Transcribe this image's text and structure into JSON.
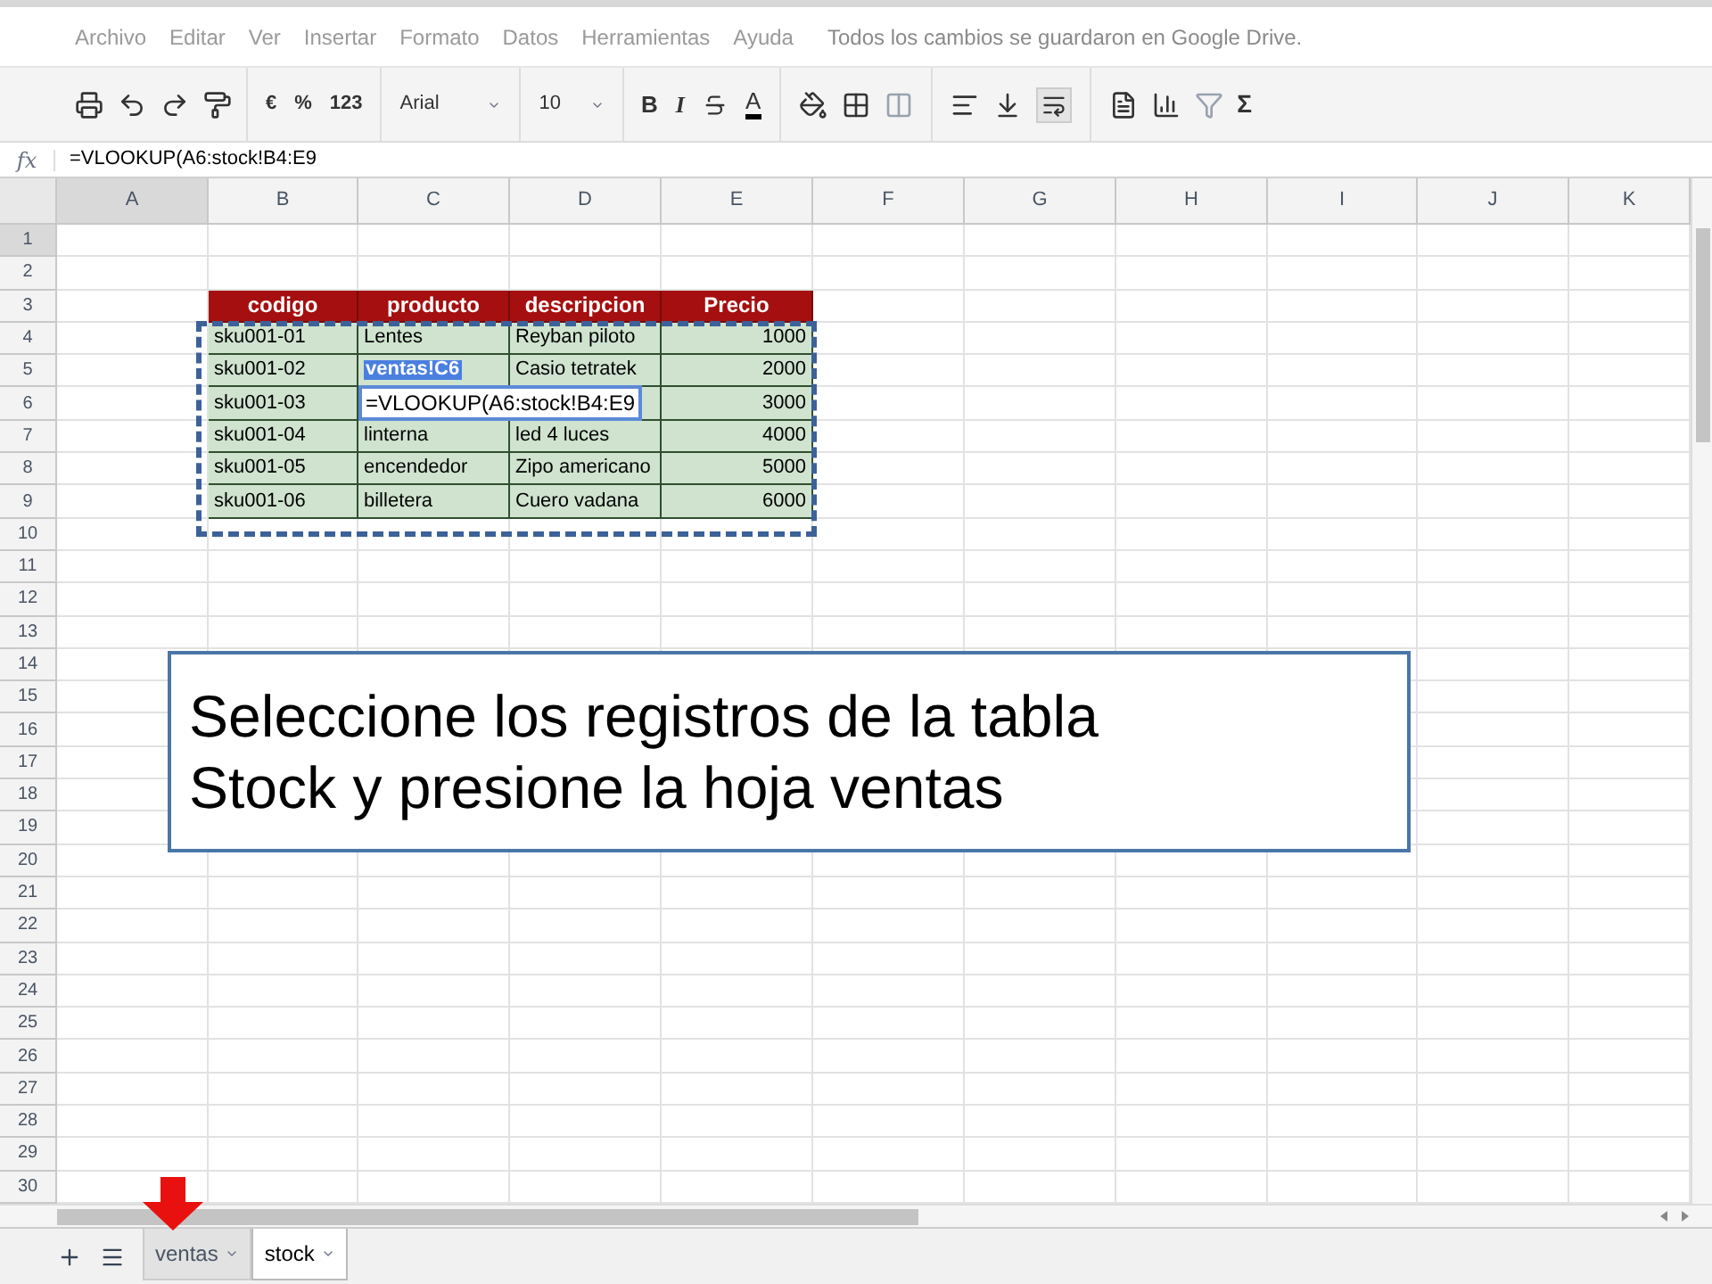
{
  "menu": {
    "items": [
      "Archivo",
      "Editar",
      "Ver",
      "Insertar",
      "Formato",
      "Datos",
      "Herramientas",
      "Ayuda"
    ],
    "save_status": "Todos los cambios se guardaron en Google Drive."
  },
  "toolbar": {
    "currency": "€",
    "percent": "%",
    "number_format": "123",
    "font": "Arial",
    "font_size": "10",
    "bold": "B",
    "italic": "I",
    "text_color": "A",
    "functions": "Σ"
  },
  "formula_bar": {
    "label": "fx",
    "value": "=VLOOKUP(A6:stock!B4:E9"
  },
  "grid": {
    "columns": [
      "A",
      "B",
      "C",
      "D",
      "E",
      "F",
      "G",
      "H",
      "I",
      "J",
      "K"
    ],
    "row_numbers": [
      "1",
      "2",
      "3",
      "4",
      "5",
      "6",
      "7",
      "8",
      "9",
      "10",
      "11",
      "12",
      "13",
      "14",
      "15",
      "16",
      "17",
      "18",
      "19",
      "20",
      "21",
      "22",
      "23",
      "24",
      "25",
      "26",
      "27",
      "28",
      "29",
      "30"
    ],
    "table": {
      "header": [
        "codigo",
        "producto",
        "descripcion",
        "Precio"
      ],
      "rows": [
        [
          {
            "kind": "text",
            "text": "sku001-01"
          },
          {
            "kind": "text",
            "text": "Lentes"
          },
          {
            "kind": "text",
            "text": "Reyban piloto"
          },
          {
            "kind": "number",
            "text": "1000"
          }
        ],
        [
          {
            "kind": "text",
            "text": "sku001-02"
          },
          {
            "kind": "reference",
            "text": "ventas!C6"
          },
          {
            "kind": "text",
            "text": "Casio tetratek"
          },
          {
            "kind": "number",
            "text": "2000"
          }
        ],
        [
          {
            "kind": "text",
            "text": "sku001-03"
          },
          {
            "kind": "editor",
            "text": "=VLOOKUP(A6:stock!B4:E9"
          },
          {
            "kind": "covered"
          },
          {
            "kind": "number",
            "text": "3000"
          }
        ],
        [
          {
            "kind": "text",
            "text": "sku001-04"
          },
          {
            "kind": "text",
            "text": "linterna"
          },
          {
            "kind": "text",
            "text": "led 4 luces"
          },
          {
            "kind": "number",
            "text": "4000"
          }
        ],
        [
          {
            "kind": "text",
            "text": "sku001-05"
          },
          {
            "kind": "text",
            "text": "encendedor"
          },
          {
            "kind": "text",
            "text": "Zipo americano"
          },
          {
            "kind": "number",
            "text": "5000"
          }
        ],
        [
          {
            "kind": "text",
            "text": "sku001-06"
          },
          {
            "kind": "text",
            "text": "billetera"
          },
          {
            "kind": "text",
            "text": "Cuero vadana"
          },
          {
            "kind": "number",
            "text": "6000"
          }
        ]
      ]
    }
  },
  "callout": {
    "lines": [
      "Seleccione los registros de la tabla",
      "Stock y presione la hoja ventas"
    ]
  },
  "sheet_tabs": [
    {
      "label": "ventas",
      "selected": false
    },
    {
      "label": "stock",
      "selected": true
    }
  ]
}
